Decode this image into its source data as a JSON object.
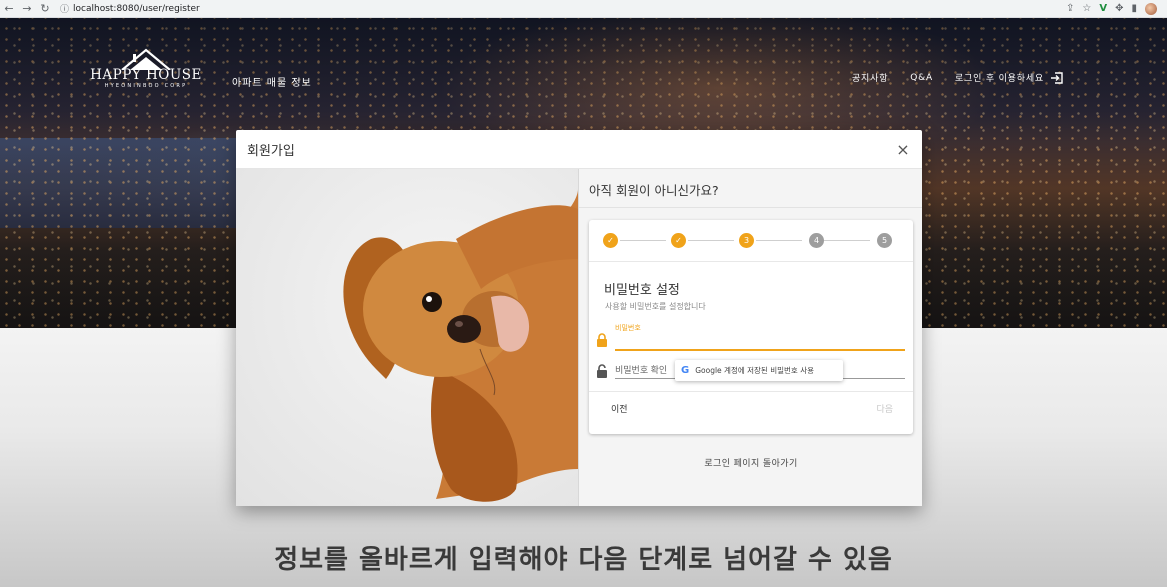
{
  "browser": {
    "url": "localhost:8080/user/register",
    "nav_icons": [
      "arrow-left-icon",
      "arrow-right-icon",
      "reload-icon"
    ],
    "right_icons": [
      "share-icon",
      "star-icon",
      "vue-devtools-icon",
      "extensions-icon",
      "sidebar-icon",
      "profile-avatar"
    ]
  },
  "site": {
    "logo_name": "HAPPY HOUSE",
    "logo_sub": "HYEONINBOO CORP",
    "nav_apt": "아파트 매물 정보",
    "nav_notice": "공지사항",
    "nav_qna": "Q&A",
    "nav_login": "로그인 후 이용하세요"
  },
  "dialog": {
    "title": "회원가입",
    "close": "×",
    "question": "아직 회원이 아니신가요?",
    "steps": [
      {
        "label": "✓",
        "state": "done"
      },
      {
        "label": "✓",
        "state": "done"
      },
      {
        "label": "3",
        "state": "active"
      },
      {
        "label": "4",
        "state": "todo"
      },
      {
        "label": "5",
        "state": "todo"
      }
    ],
    "form_title": "비밀번호 설정",
    "form_subtitle": "사용할 비밀번호를 설정합니다",
    "password_label": "비밀번호",
    "password_value": "",
    "password_confirm_placeholder": "비밀번호 확인",
    "google_suggestion": "Google 계정에 저장된 비밀번호 사용",
    "prev_button": "이전",
    "next_button": "다음",
    "back_to_login": "로그인 페이지 돌아가기"
  },
  "caption": "정보를 올바르게 입력해야 다음 단계로 넘어갈 수 있음",
  "colors": {
    "accent": "#f0a31a",
    "step_todo": "#9e9e9e"
  }
}
